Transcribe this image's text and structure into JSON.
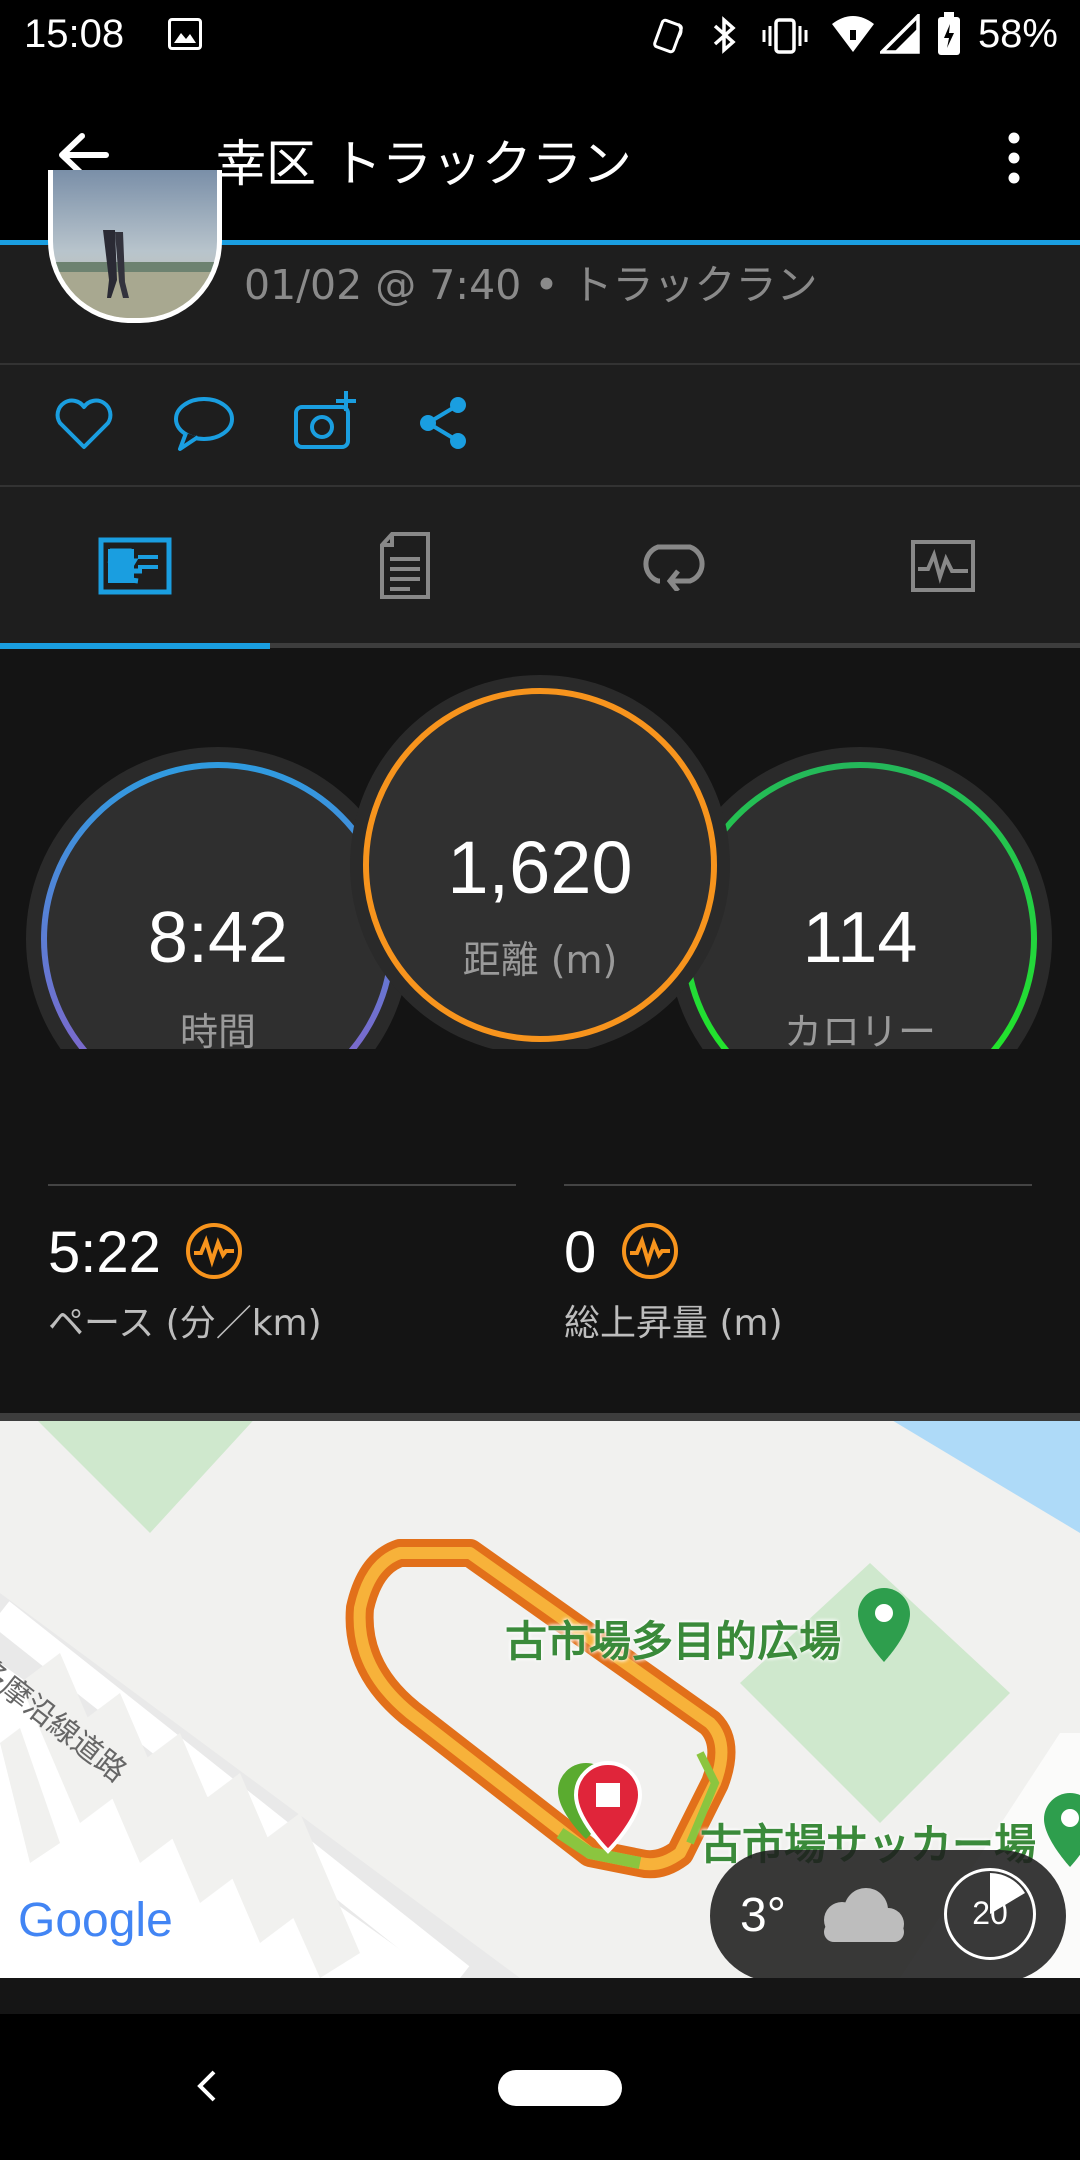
{
  "status_bar": {
    "time": "15:08",
    "battery": "58%"
  },
  "app_bar": {
    "title": "幸区 トラックラン"
  },
  "activity": {
    "subtitle": "01/02 @ 7:40 • トラックラン"
  },
  "stats": {
    "time": {
      "value": "8:42",
      "label": "時間"
    },
    "distance": {
      "value": "1,620",
      "label": "距離",
      "unit": "(m)"
    },
    "calories": {
      "value": "114",
      "label": "カロリー"
    },
    "pace": {
      "value": "5:22",
      "label": "ペース",
      "unit": "(分／km)"
    },
    "ascent": {
      "value": "0",
      "label": "総上昇量",
      "unit": "(m)"
    }
  },
  "map": {
    "road_label": "多摩沿線道路",
    "place1": "古市場多目的広場",
    "place2": "古市場サッカー場",
    "google": "Google"
  },
  "weather": {
    "temp": "3°",
    "wind": "20"
  },
  "colors": {
    "accent": "#1a9ee0",
    "time_ring": "#4a90e2",
    "distance_ring": "#f7941d",
    "calories_ring": "#22dd33"
  }
}
